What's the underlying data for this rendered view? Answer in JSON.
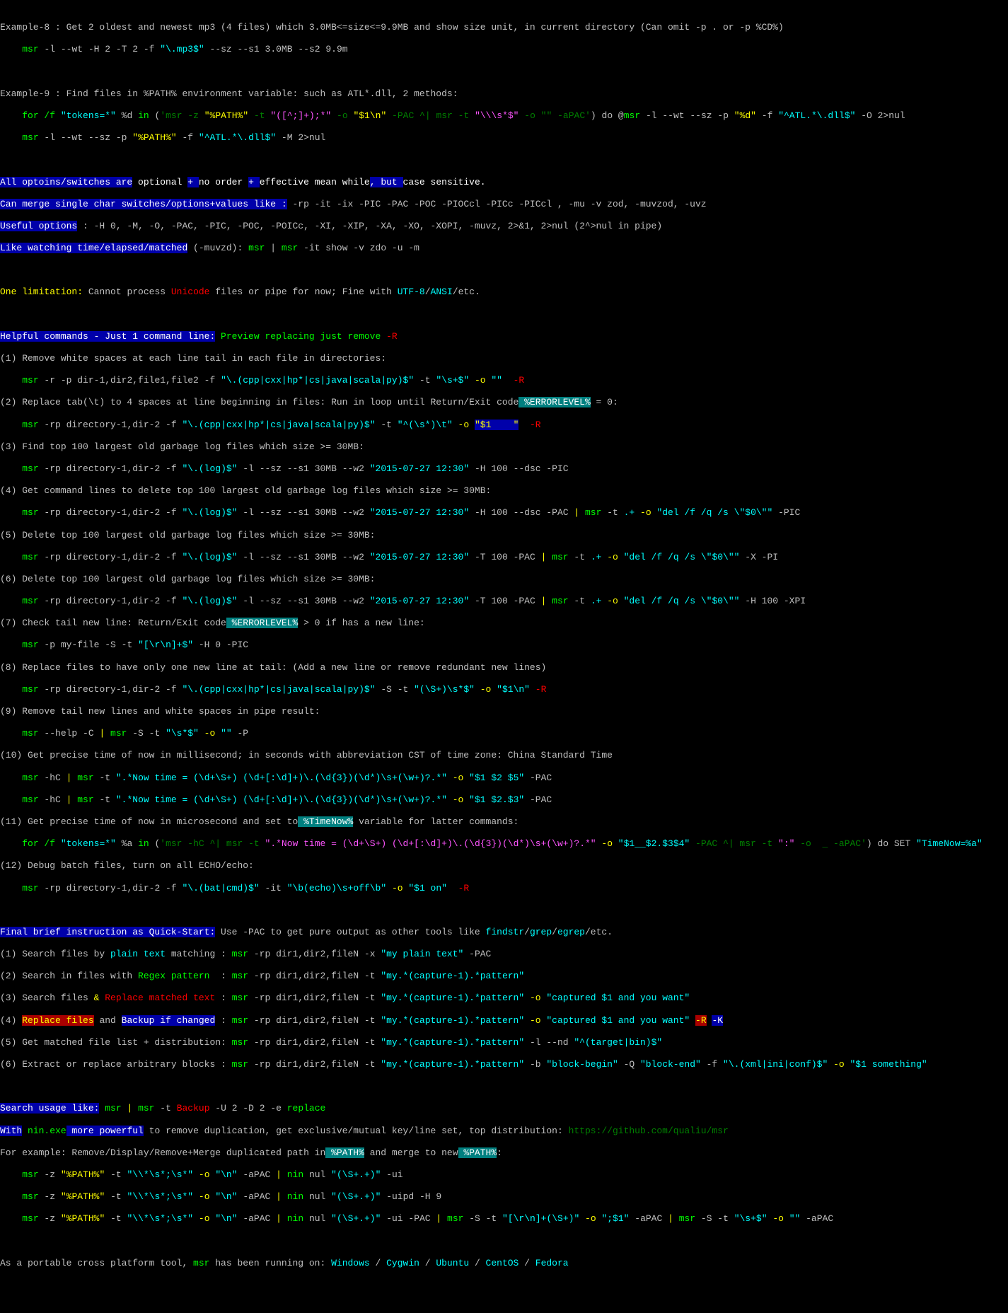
{
  "ex8": {
    "lead": "Example-8 : Get 2 oldest and newest mp3 (4 files) which 3.0MB<=size<=9.9MB and show size unit, in current directory (Can omit -p . or -p %CD%)",
    "cmd": "msr",
    "sw": "-l --wt -H 2 -T 2 -f",
    "q1": "\"\\.mp3$\"",
    "sz1": "--sz --s1 3.0MB --s2 9.9m"
  },
  "ex9": {
    "lead": "Example-9 : Find files in %PATH% environment variable: such as ATL*.dll, 2 methods:",
    "a1": "for /f",
    "a2": "\"tokens=*\"",
    "a3": "%d",
    "a4": "in",
    "a5": "(",
    "a6": "'msr -z ",
    "a7": "\"%PATH%\"",
    "a8": " -t",
    "a9": "\"([^;]+);*\"",
    "a10": " -o ",
    "a11": "\"$1\\n\"",
    "a12": " -PAC ^| msr -t ",
    "a13": "\"\\\\\\s*$\"",
    "a14": " -o \"\" -aPAC'",
    "a15": ") do @",
    "a16": "msr",
    "a17": " -l --wt --sz -p ",
    "a18": "\"%d\"",
    "a19": " -f ",
    "a20": "\"^ATL.*\\.dll$\"",
    "a21": " -O 2>nul",
    "b1": "msr",
    "b2": " -l --wt --sz -p",
    "b3": "\"%PATH%\"",
    "b4": " -f ",
    "b5": "\"^ATL.*\\.dll$\"",
    "b6": " -M 2>nul"
  },
  "opt": {
    "l1a": "All optoins/switches are",
    "l1b": " optional ",
    "l1c": "+ ",
    "l1d": "no order ",
    "l1e": "+ ",
    "l1f": "effective mean while",
    "l1g": ", but ",
    "l1h": "case sensitive.",
    "l2a": "Can merge single char switches/options+values like :",
    "l2b": " -rp -it -ix -PIC -PAC -POC -PIOCcl -PICc -PICcl , -mu -v zod, -muvzod, -uvz",
    "l3a": "Useful options",
    "l3b": " : -H 0, -M, -O, -PAC, -PIC, -POC, -POICc, -XI, -XIP, -XA, -XO, -XOPI, -muvz, 2>&1, 2>nul (2^>nul in pipe)",
    "l4a": "Like watching time/elapsed/matched",
    "l4b": " (-muvzd): ",
    "l4c": "msr",
    "l4d": " | ",
    "l4e": "msr",
    "l4f": " -it show -v zdo -u -m"
  },
  "lim": {
    "a": "One limitation:",
    "b": " Cannot process ",
    "c": "Unicode",
    "d": " files or pipe for now; Fine with ",
    "e": "UTF-8",
    "f": "/",
    "g": "ANSI",
    "h": "/etc."
  },
  "help": {
    "hdr": "Helpful commands - Just 1 command line:",
    "prev": " Preview replacing just remove",
    "pr": " -R",
    "n1": "(1) Remove white spaces at each line tail in each file in directories:",
    "c1": "msr",
    "c1a": " -r -p dir-1,dir2,file1,file2 -f ",
    "c1b": "\"\\.(cpp|cxx|hp*|cs|java|scala|py)$\"",
    "c1c": " -t ",
    "c1d": "\"\\s+$\"",
    "c1e": " -o",
    "c1f": " \"\"",
    "c1g": "  -R",
    "n2": "(2) Replace tab(\\t) to 4 spaces at line beginning in files: Run in loop until Return/Exit code",
    "n2b": " %ERRORLEVEL%",
    "n2c": " = 0:",
    "c2": "msr",
    "c2a": " -rp directory-1,dir-2 -f ",
    "c2b": "\"\\.(cpp|cxx|hp*|cs|java|scala|py)$\"",
    "c2c": " -t ",
    "c2d": "\"^(\\s*)\\t\"",
    "c2e": " -o",
    "c2f": "\"$1    \"",
    "c2g": "  -R",
    "n3": "(3) Find top 100 largest old garbage log files which size >= 30MB:",
    "c3": "msr",
    "c3a": " -rp directory-1,dir-2 -f ",
    "c3b": "\"\\.(log)$\"",
    "c3c": " -l --sz --s1 30MB --w2 ",
    "c3d": "\"2015-07-27 12:30\"",
    "c3e": " -H 100 --dsc -PIC",
    "n4": "(4) Get command lines to delete top 100 largest old garbage log files which size >= 30MB:",
    "c4": "msr",
    "c4a": " -rp directory-1,dir-2 -f ",
    "c4b": "\"\\.(log)$\"",
    "c4c": " -l --sz --s1 30MB --w2 ",
    "c4d": "\"2015-07-27 12:30\"",
    "c4e": " -H 100 --dsc -PAC",
    "c4f": " | ",
    "c4g": "msr",
    "c4h": " -t ",
    "c4i": ".+",
    "c4j": " -o",
    "c4k": " \"del /f /q /s \\\"$0\\\"\"",
    "c4l": " -PIC",
    "n5": "(5) Delete top 100 largest old garbage log files which size >= 30MB:",
    "c5": "msr",
    "c5a": " -rp directory-1,dir-2 -f ",
    "c5b": "\"\\.(log)$\"",
    "c5c": " -l --sz --s1 30MB --w2 ",
    "c5d": "\"2015-07-27 12:30\"",
    "c5e": " -T 100 -PAC",
    "c5f": " | ",
    "c5g": "msr",
    "c5h": " -t ",
    "c5i": ".+",
    "c5j": " -o",
    "c5k": " \"del /f /q /s \\\"$0\\\"\"",
    "c5l": " -X -PI",
    "n6": "(6) Delete top 100 largest old garbage log files which size >= 30MB:",
    "c6": "msr",
    "c6a": " -rp directory-1,dir-2 -f ",
    "c6b": "\"\\.(log)$\"",
    "c6c": " -l --sz --s1 30MB --w2 ",
    "c6d": "\"2015-07-27 12:30\"",
    "c6e": " -T 100 -PAC",
    "c6f": " | ",
    "c6g": "msr",
    "c6h": " -t ",
    "c6i": ".+",
    "c6j": " -o",
    "c6k": " \"del /f /q /s \\\"$0\\\"\"",
    "c6l": " -H 100 -XPI",
    "n7": "(7) Check tail new line: Return/Exit code",
    "n7b": " %ERRORLEVEL%",
    "n7c": " > 0 if has a new line:",
    "c7": "msr",
    "c7a": " -p my-file -S -t ",
    "c7b": "\"[\\r\\n]+$\"",
    "c7c": " -H 0 -PIC",
    "n8": "(8) Replace files to have only one new line at tail: (Add a new line or remove redundant new lines)",
    "c8": "msr",
    "c8a": " -rp directory-1,dir-2 -f ",
    "c8b": "\"\\.(cpp|cxx|hp*|cs|java|scala|py)$\"",
    "c8c": " -S -t ",
    "c8d": "\"(\\S+)\\s*$\"",
    "c8e": " -o",
    "c8f": " \"$1\\n\"",
    "c8g": " -R",
    "n9": "(9) Remove tail new lines and white spaces in pipe result:",
    "c9": "msr",
    "c9a": " --help -C",
    "c9b": " | ",
    "c9c": "msr",
    "c9d": " -S -t ",
    "c9e": "\"\\s*$\"",
    "c9f": " -o",
    "c9g": " \"\"",
    "c9h": " -P",
    "n10": "(10) Get precise time of now in millisecond; in seconds with abbreviation CST of time zone: China Standard Time",
    "c10": "msr",
    "c10a": " -hC",
    "c10b": " | ",
    "c10c": "msr",
    "c10d": " -t ",
    "c10e": "\".*Now time = (\\d+\\S+) (\\d+[:\\d]+)\\.(\\d{3})(\\d*)\\s+(\\w+)?.*\"",
    "c10f": " -o",
    "c10g": " \"$1 $2 $5\"",
    "c10h": " -PAC",
    "c10i": "msr",
    "c10j": " -hC",
    "c10k": " | ",
    "c10l": "msr",
    "c10m": " -t ",
    "c10n": "\".*Now time = (\\d+\\S+) (\\d+[:\\d]+)\\.(\\d{3})(\\d*)\\s+(\\w+)?.*\"",
    "c10o": " -o",
    "c10p": " \"$1 $2.$3\"",
    "c10q": " -PAC",
    "n11": "(11) Get precise time of now in microsecond and set to",
    "n11b": " %TimeNow%",
    "n11c": " variable for latter commands:",
    "c11": "for /f",
    "c11a": " \"tokens=*\"",
    "c11b": " %a",
    "c11c": " in",
    "c11d": " (",
    "c11e": "'msr -hC ^| msr -t ",
    "c11f": "\".*Now time = (\\d+\\S+) (\\d+[:\\d]+)\\.(\\d{3})(\\d*)\\s+(\\w+)?.*\"",
    "c11g": " -o",
    "c11h": " \"$1__$2.$3$4\"",
    "c11i": " -PAC ^| msr -t ",
    "c11j": "\":\"",
    "c11k": " -o  _ -aPAC'",
    "c11l": ") do SET ",
    "c11m": "\"TimeNow=%a\"",
    "n12": "(12) Debug batch files, turn on all ECHO/echo:",
    "c12": "msr",
    "c12a": " -rp directory-1,dir-2 -f ",
    "c12b": "\"\\.(bat|cmd)$\"",
    "c12c": " -it ",
    "c12d": "\"\\b(echo)\\s+off\\b\"",
    "c12e": " -o",
    "c12f": " \"$1 on\" ",
    "c12g": " -R"
  },
  "fin": {
    "hdr": "Final brief instruction as Quick-Start:",
    "hdr2": " Use -PAC to get pure output as other tools like ",
    "tools1": "findstr",
    "sl1": "/",
    "tools2": "grep",
    "sl2": "/",
    "tools3": "egrep",
    "etc": "/etc.",
    "r1": "(1) Search files by ",
    "r1b": "plain text",
    "r1c": " matching",
    "r1d": " : ",
    "r1e": "msr",
    "r1f": " -rp dir1,dir2,fileN -x ",
    "r1g": "\"my plain text\"",
    "r1h": " -PAC",
    "r2": "(2) Search in files with ",
    "r2b": "Regex pattern",
    "r2c": "  : ",
    "r2d": "msr",
    "r2e": " -rp dir1,dir2,fileN -t ",
    "r2f": "\"my.*(capture-1).*pattern\"",
    "r3": "(3) Search files ",
    "r3b": "&",
    "r3c": " ",
    "r3d": "Replace matched text",
    "r3e": " : ",
    "r3f": "msr",
    "r3g": " -rp dir1,dir2,fileN -t ",
    "r3h": "\"my.*(capture-1).*pattern\"",
    "r3i": " -o",
    "r3j": " \"captured $1 and you want\"",
    "r4": "(4) ",
    "r4b": "Replace files",
    "r4c": " and ",
    "r4d": "Backup if changed",
    "r4e": " : ",
    "r4f": "msr",
    "r4g": " -rp dir1,dir2,fileN -t ",
    "r4h": "\"my.*(capture-1).*pattern\"",
    "r4i": " -o",
    "r4j": " \"captured $1 and you want\"",
    "r4k": "-R",
    "r4l": "-K",
    "r5": "(5) Get matched file list + distribution: ",
    "r5b": "msr",
    "r5c": " -rp dir1,dir2,fileN -t ",
    "r5d": "\"my.*(capture-1).*pattern\"",
    "r5e": " -l --nd ",
    "r5f": "\"^(target|bin)$\"",
    "r6": "(6) Extract or replace arbitrary blocks : ",
    "r6b": "msr",
    "r6c": " -rp dir1,dir2,fileN -t ",
    "r6d": "\"my.*(capture-1).*pattern\"",
    "r6e": " -b ",
    "r6f": "\"block-begin\"",
    "r6g": " -Q ",
    "r6h": "\"block-end\"",
    "r6i": " -f ",
    "r6j": "\"\\.(xml|ini|conf)$\"",
    "r6k": " -o",
    "r6l": " \"$1 something\""
  },
  "srch": {
    "hdr": "Search usage like:",
    "p1": "msr",
    "p2": " | ",
    "p3": "msr",
    "p4": " -t ",
    "p5": "Backup",
    "p6": " -U 2 -D 2 -e ",
    "p7": "replace",
    "nin1": "With",
    "nin2": " nin.exe",
    "nin3": " more powerful",
    "nin4": " to remove duplication, get exclusive/mutual key/line set, top distribution: ",
    "url": "https://github.com/qualiu/msr",
    "fx": "For example: Remove/Display/Remove+Merge duplicated path in",
    "fxb": " %PATH%",
    "fxc": " and merge to new",
    "fxd": " %PATH%",
    "fxe": ":",
    "e1": "msr",
    "e1a": " -z ",
    "e1b": "\"%PATH%\"",
    "e1c": " -t ",
    "e1d": "\"\\\\*\\s*;\\s*\"",
    "e1e": " -o",
    "e1f": " \"\\n\"",
    "e1g": " -aPAC",
    "e1h": " | ",
    "e1i": "nin",
    "e1j": " nul ",
    "e1k": "\"(\\S+.+)\"",
    "e1l": " -ui",
    "e2": "msr",
    "e2a": " -z ",
    "e2b": "\"%PATH%\"",
    "e2c": " -t ",
    "e2d": "\"\\\\*\\s*;\\s*\"",
    "e2e": " -o",
    "e2f": " \"\\n\"",
    "e2g": " -aPAC",
    "e2h": " | ",
    "e2i": "nin",
    "e2j": " nul ",
    "e2k": "\"(\\S+.+)\"",
    "e2l": " -uipd -H 9",
    "e3": "msr",
    "e3a": " -z ",
    "e3b": "\"%PATH%\"",
    "e3c": " -t ",
    "e3d": "\"\\\\*\\s*;\\s*\"",
    "e3e": " -o",
    "e3f": " \"\\n\"",
    "e3g": " -aPAC",
    "e3h": " | ",
    "e3i": "nin",
    "e3j": " nul ",
    "e3k": "\"(\\S+.+)\"",
    "e3l": " -ui -PAC",
    "e3m": " | ",
    "e3n": "msr",
    "e3o": " -S -t ",
    "e3p": "\"[\\r\\n]+(\\S+)\"",
    "e3q": " -o",
    "e3r": " \";$1\"",
    "e3s": " -aPAC",
    "e3t": " | ",
    "e3u": "msr",
    "e3v": " -S -t ",
    "e3w": "\"\\s+$\"",
    "e3x": " -o",
    "e3y": " \"\"",
    "e3z": " -aPAC"
  },
  "ft": {
    "a": "As a portable cross platform tool, ",
    "b": "msr",
    "c": " has been running on: ",
    "d": "Windows",
    "e": " / ",
    "f": "Cygwin",
    "g": " / ",
    "h": "Ubuntu",
    "i": " / ",
    "j": "CentOS",
    "k": " / ",
    "l": "Fedora"
  }
}
